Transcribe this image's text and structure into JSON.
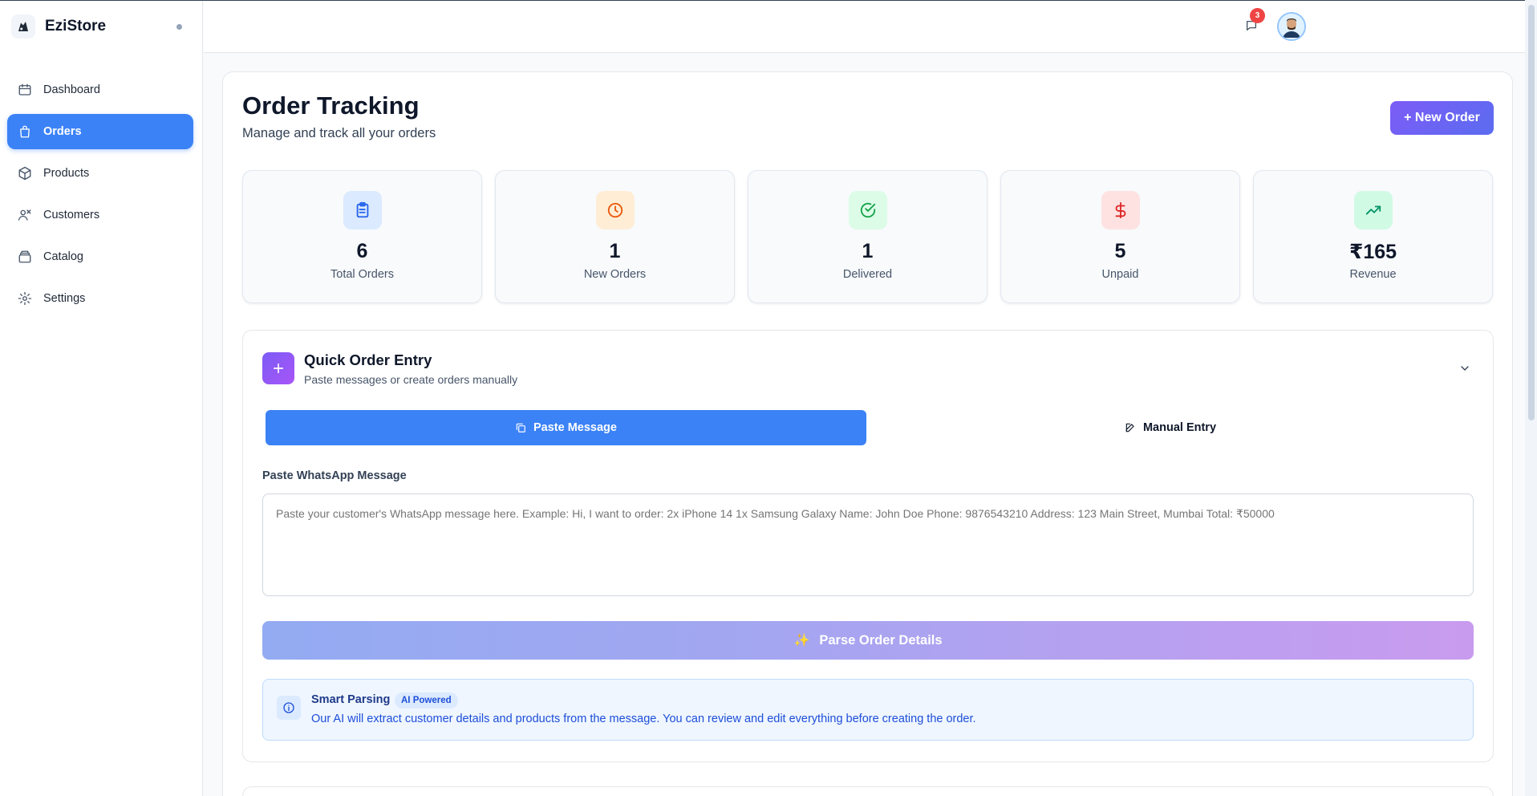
{
  "brand": {
    "name": "EziStore"
  },
  "sidebar": {
    "items": [
      {
        "label": "Dashboard",
        "icon": "dashboard-icon",
        "active": false
      },
      {
        "label": "Orders",
        "icon": "shopping-bag-icon",
        "active": true
      },
      {
        "label": "Products",
        "icon": "box-icon",
        "active": false
      },
      {
        "label": "Customers",
        "icon": "users-icon",
        "active": false
      },
      {
        "label": "Catalog",
        "icon": "catalog-icon",
        "active": false
      },
      {
        "label": "Settings",
        "icon": "gear-icon",
        "active": false
      }
    ]
  },
  "header": {
    "notification_count": "3"
  },
  "page": {
    "title": "Order Tracking",
    "subtitle": "Manage and track all your orders",
    "new_order_label": "+ New Order"
  },
  "stats": [
    {
      "value": "6",
      "label": "Total Orders",
      "icon": "clipboard-icon",
      "color": "#2563eb",
      "bg": "#dbeafe"
    },
    {
      "value": "1",
      "label": "New Orders",
      "icon": "clock-icon",
      "color": "#ea580c",
      "bg": "#ffedd5"
    },
    {
      "value": "1",
      "label": "Delivered",
      "icon": "check-circle-icon",
      "color": "#16a34a",
      "bg": "#dcfce7"
    },
    {
      "value": "5",
      "label": "Unpaid",
      "icon": "dollar-icon",
      "color": "#dc2626",
      "bg": "#fee2e2"
    },
    {
      "value": "₹165",
      "label": "Revenue",
      "icon": "trending-up-icon",
      "color": "#059669",
      "bg": "#d1fae5"
    }
  ],
  "quick_entry": {
    "title": "Quick Order Entry",
    "subtitle": "Paste messages or create orders manually",
    "tabs": {
      "paste": "Paste Message",
      "manual": "Manual Entry"
    },
    "field_label": "Paste WhatsApp Message",
    "placeholder": "Paste your customer's WhatsApp message here. Example: Hi, I want to order: 2x iPhone 14 1x Samsung Galaxy Name: John Doe Phone: 9876543210 Address: 123 Main Street, Mumbai Total: ₹50000",
    "parse_label": "Parse Order Details",
    "info": {
      "title": "Smart Parsing",
      "badge": "AI Powered",
      "text": "Our AI will extract customer details and products from the message. You can review and edit everything before creating the order."
    }
  },
  "colors": {
    "accent": "#3b82f6",
    "brand_purple": "#6d5ef5"
  }
}
